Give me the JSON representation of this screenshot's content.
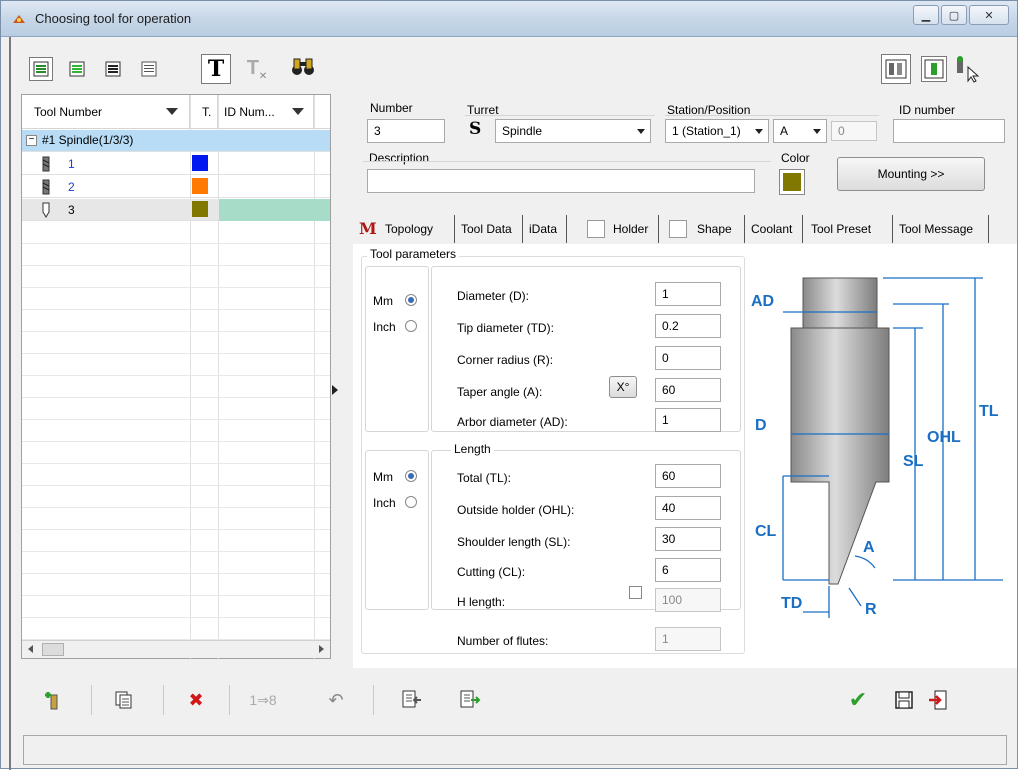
{
  "window": {
    "title": "Choosing tool for operation"
  },
  "tree": {
    "columns": [
      {
        "label": "Tool Number"
      },
      {
        "label": "T."
      },
      {
        "label": "ID Num..."
      }
    ],
    "group": {
      "label": "#1 Spindle(1/3/3)"
    },
    "rows": [
      {
        "num": "1",
        "color": "#0018f0"
      },
      {
        "num": "2",
        "color": "#ff7a00"
      },
      {
        "num": "3",
        "color": "#807800"
      }
    ]
  },
  "form": {
    "number": {
      "label": "Number",
      "value": "3"
    },
    "turret": {
      "label": "Turret",
      "value": "Spindle"
    },
    "station": {
      "label": "Station/Position",
      "value": "1 (Station_1)",
      "pos": "A",
      "extra": "0"
    },
    "id_number": {
      "label": "ID number",
      "value": ""
    },
    "description": {
      "label": "Description",
      "value": ""
    },
    "color": {
      "label": "Color",
      "value": "#807800"
    },
    "mounting_button": "Mounting >>"
  },
  "tabs": [
    {
      "label": "Topology"
    },
    {
      "label": "Tool Data"
    },
    {
      "label": "iData"
    },
    {
      "label": "Holder"
    },
    {
      "label": "Shape"
    },
    {
      "label": "Coolant"
    },
    {
      "label": "Tool Preset"
    },
    {
      "label": "Tool Message"
    }
  ],
  "tool_parameters": {
    "title": "Tool parameters",
    "unit_mm": "Mm",
    "unit_inch": "Inch",
    "fields": [
      {
        "label": "Diameter (D):",
        "value": "1"
      },
      {
        "label": "Tip diameter (TD):",
        "value": "0.2"
      },
      {
        "label": "Corner radius (R):",
        "value": "0"
      },
      {
        "label": "Taper angle (A):",
        "value": "60"
      },
      {
        "label": "Arbor diameter (AD):",
        "value": "1"
      }
    ],
    "x_button": "X°"
  },
  "length": {
    "title": "Length",
    "unit_mm": "Mm",
    "unit_inch": "Inch",
    "fields": [
      {
        "label": "Total (TL):",
        "value": "60"
      },
      {
        "label": "Outside holder (OHL):",
        "value": "40"
      },
      {
        "label": "Shoulder length (SL):",
        "value": "30"
      },
      {
        "label": "Cutting (CL):",
        "value": "6"
      },
      {
        "label": "H length:",
        "value": "100"
      }
    ]
  },
  "flutes": {
    "label": "Number of flutes:",
    "value": "1"
  },
  "diagram": {
    "labels": {
      "ad": "AD",
      "d": "D",
      "cl": "CL",
      "td": "TD",
      "r": "R",
      "a": "A",
      "sl": "SL",
      "ohl": "OHL",
      "tl": "TL"
    },
    "dim_color": "#1a6fc4"
  },
  "toolbar_bottom": {
    "renumber_label": "1⇒8"
  },
  "colors": {
    "accent_green": "#2aa02a",
    "delete_red": "#d01818",
    "selected_row": "#b8dcf6"
  }
}
